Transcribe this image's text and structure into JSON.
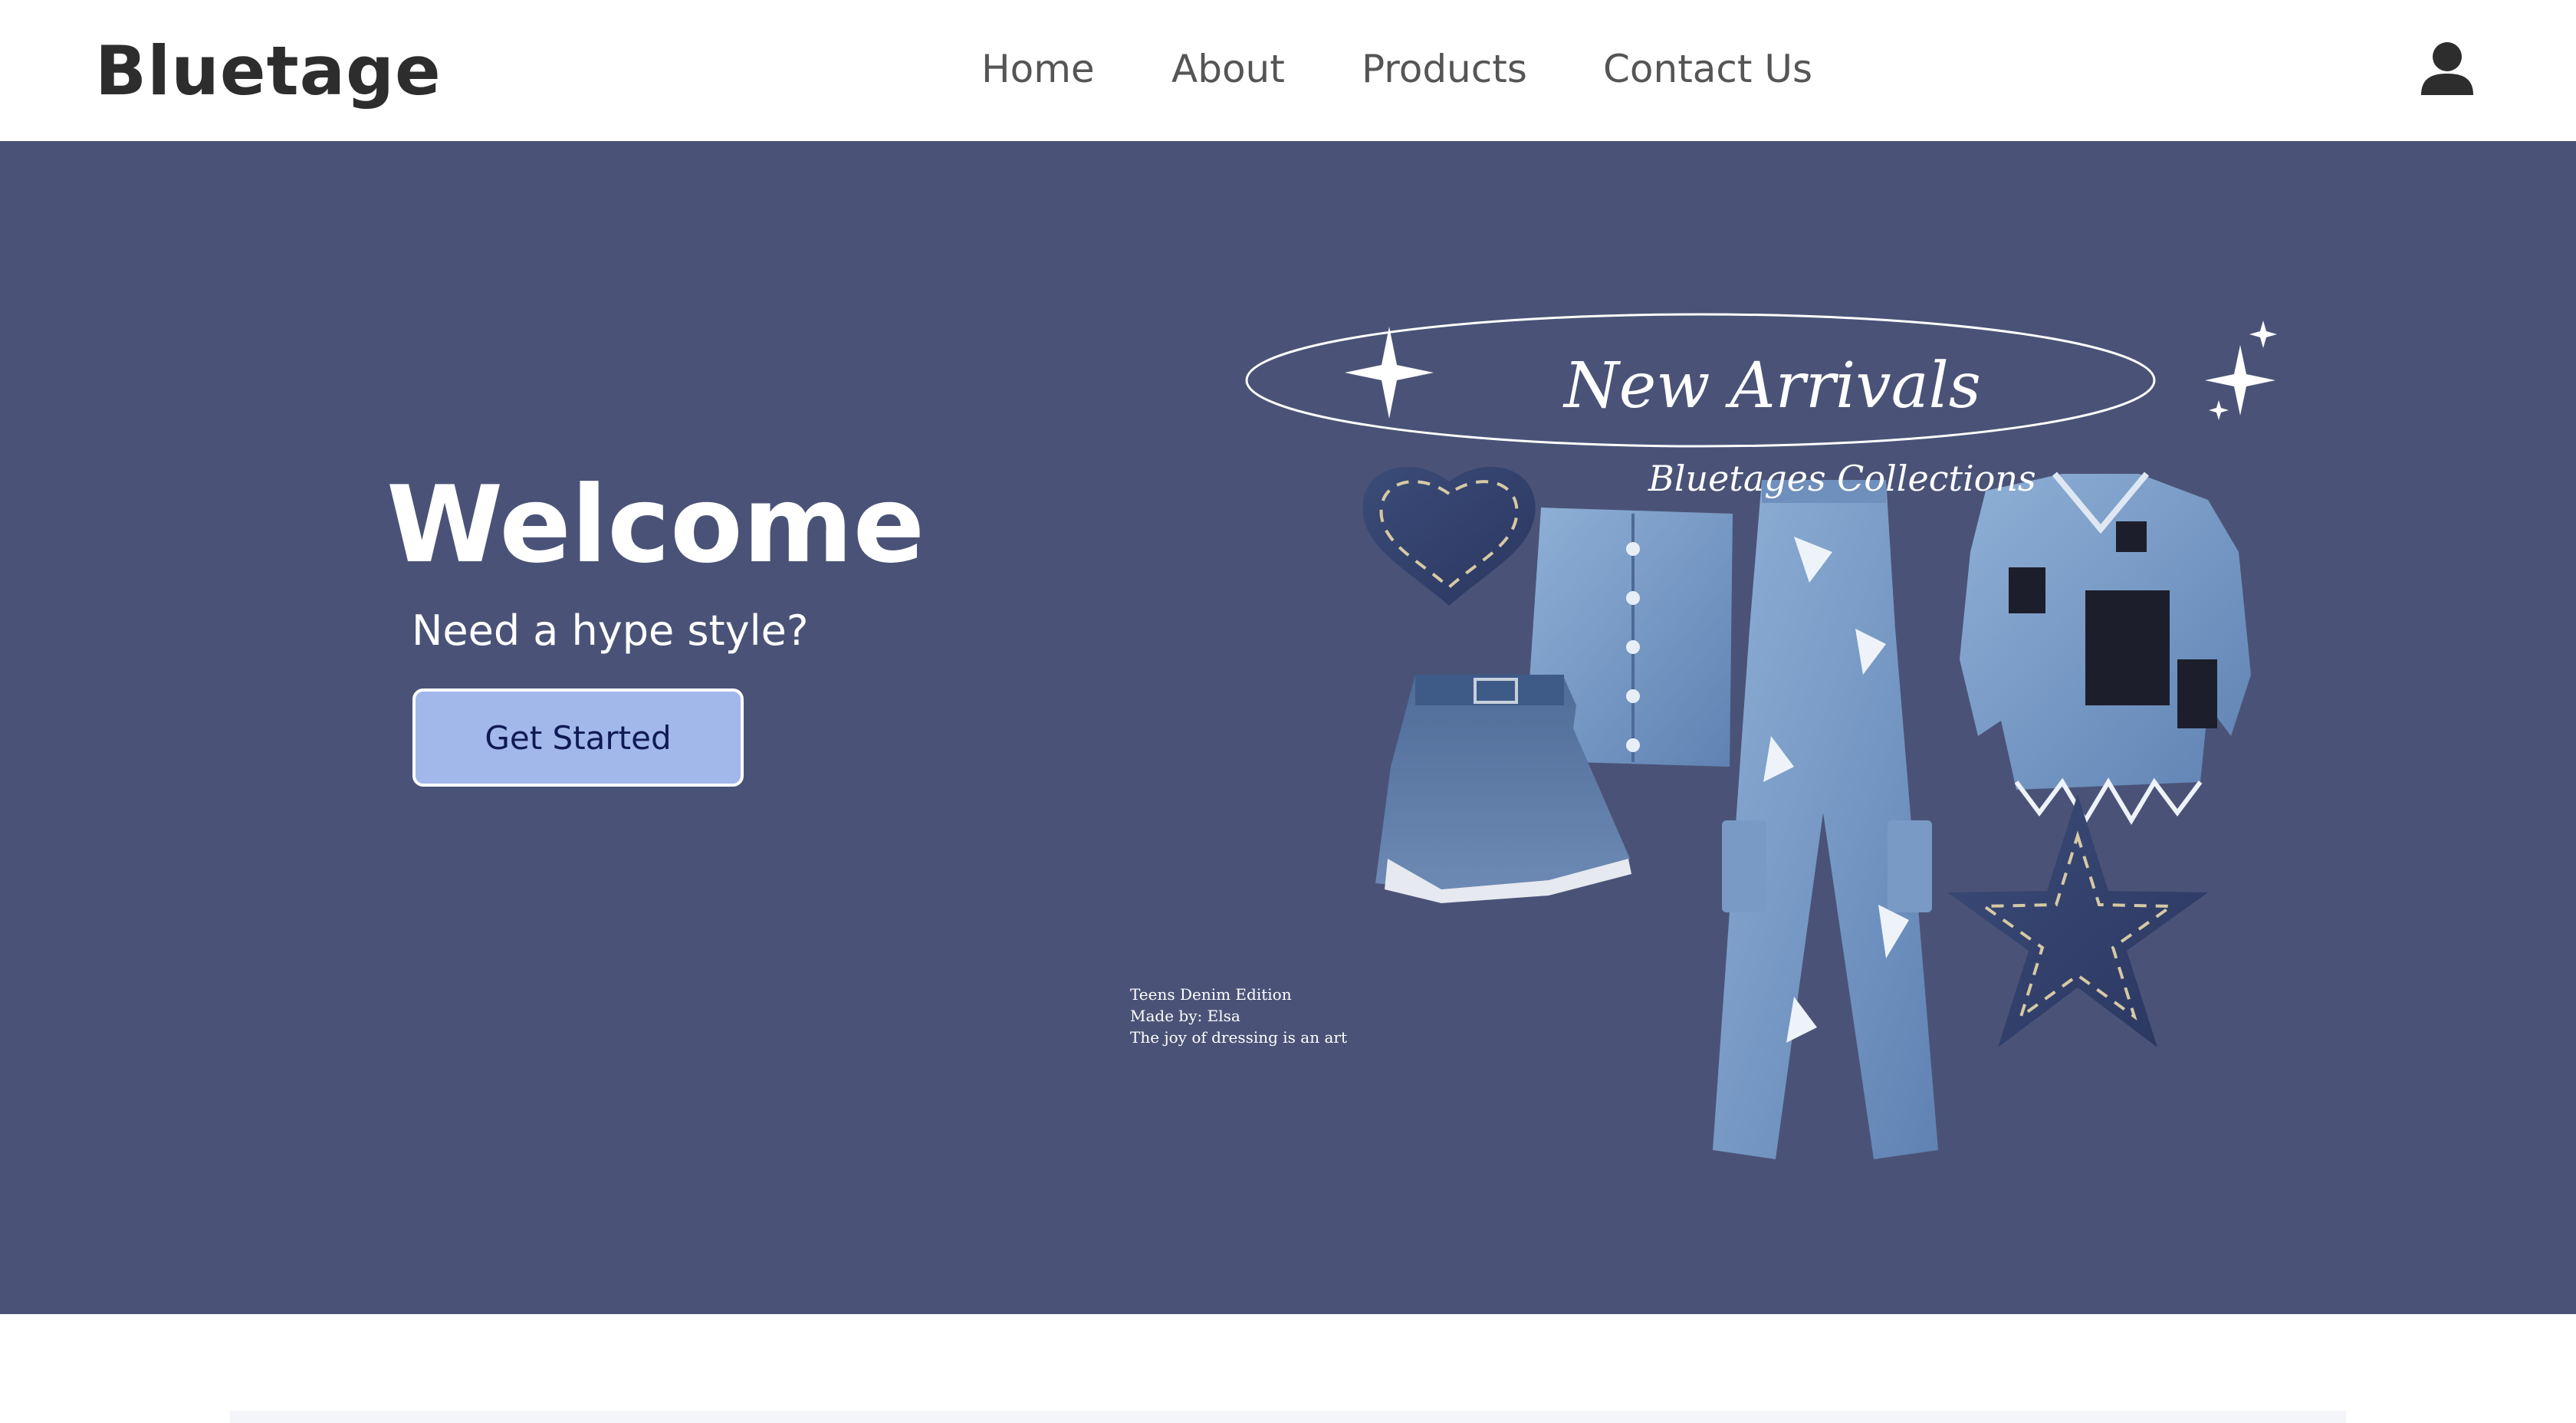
{
  "brand": {
    "logo": "Bluetage"
  },
  "nav": {
    "items": [
      "Home",
      "About",
      "Products",
      "Contact Us"
    ]
  },
  "hero": {
    "title": "Welcome",
    "subtitle": "Need a hype style?",
    "cta_label": "Get Started",
    "background_color": "#4a5377",
    "cta_color": "#a2b7ea"
  },
  "promo": {
    "title": "New Arrivals",
    "subtitle": "Bluetages Collections",
    "notes": [
      "Teens Denim Edition",
      "Made by: Elsa",
      "The joy of dressing is an art"
    ]
  },
  "icons": {
    "user": "user-icon"
  }
}
